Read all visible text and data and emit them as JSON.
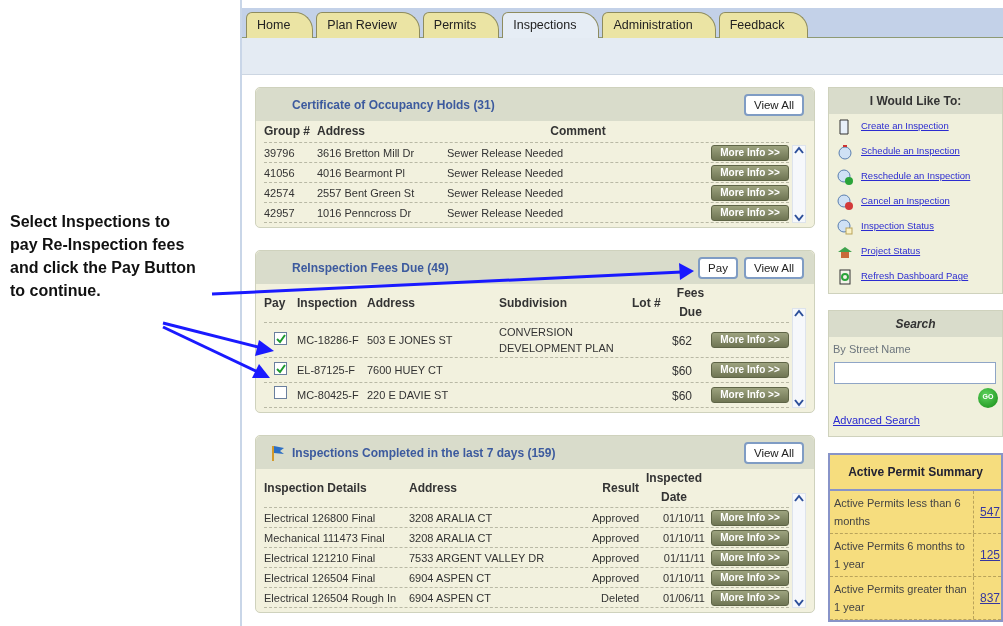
{
  "annotation": "Select Inspections to pay Re-Inspection fees and click the Pay Button to continue.",
  "tabs": [
    {
      "label": "Home",
      "selected": false
    },
    {
      "label": "Plan Review",
      "selected": false
    },
    {
      "label": "Permits",
      "selected": false
    },
    {
      "label": "Inspections",
      "selected": true
    },
    {
      "label": "Administration",
      "selected": false
    },
    {
      "label": "Feedback",
      "selected": false
    }
  ],
  "panels": [
    {
      "kind": "holds",
      "title": "Certificate of Occupancy Holds (31)",
      "buttons": [
        "View All"
      ],
      "columns": [
        "Group #",
        "Address",
        "Comment"
      ],
      "rows": [
        {
          "group": "39796",
          "address": "3616 Bretton Mill Dr",
          "comment": "Sewer Release Needed",
          "action": "More Info >>"
        },
        {
          "group": "41056",
          "address": "4016 Bearmont Pl",
          "comment": "Sewer Release Needed",
          "action": "More Info >>"
        },
        {
          "group": "42574",
          "address": "2557 Bent Green St",
          "comment": "Sewer Release Needed",
          "action": "More Info >>"
        },
        {
          "group": "42957",
          "address": "1016 Penncross Dr",
          "comment": "Sewer Release Needed",
          "action": "More Info >>"
        }
      ]
    },
    {
      "kind": "fees",
      "title": "ReInspection Fees Due (49)",
      "buttons": [
        "Pay",
        "View All"
      ],
      "columns": [
        "Pay",
        "Inspection",
        "Address",
        "Subdivision",
        "Lot #",
        "Fees Due"
      ],
      "rows": [
        {
          "checked": true,
          "inspection": "MC-18286-F",
          "address": "503 E JONES ST",
          "subdivision": "CONVERSION DEVELOPMENT PLAN",
          "fees_due": "$62",
          "action": "More Info >>"
        },
        {
          "checked": true,
          "inspection": "EL-87125-F",
          "address": "7600 HUEY CT",
          "fees_due": "$60",
          "action": "More Info >>"
        },
        {
          "checked": false,
          "inspection": "MC-80425-F",
          "address": "220 E DAVIE ST",
          "fees_due": "$60",
          "action": "More Info >>"
        }
      ]
    },
    {
      "kind": "completed",
      "title": "Inspections Completed in the last 7 days (159)",
      "buttons": [
        "View All"
      ],
      "columns": [
        "Inspection Details",
        "Address",
        "Result",
        "Inspected Date"
      ],
      "rows": [
        {
          "details": "Electrical 126800 Final",
          "address": "3208 ARALIA CT",
          "result": "Approved",
          "date": "01/10/11",
          "action": "More Info >>"
        },
        {
          "details": "Mechanical 111473 Final",
          "address": "3208 ARALIA CT",
          "result": "Approved",
          "date": "01/10/11",
          "action": "More Info >>"
        },
        {
          "details": "Electrical 121210 Final",
          "address": "7533 ARGENT VALLEY DR",
          "result": "Approved",
          "date": "01/11/11",
          "action": "More Info >>"
        },
        {
          "details": "Electrical 126504 Final",
          "address": "6904 ASPEN CT",
          "result": "Approved",
          "date": "01/10/11",
          "action": "More Info >>"
        },
        {
          "details": "Electrical 126504 Rough In",
          "address": "6904 ASPEN CT",
          "result": "Deleted",
          "date": "01/06/11",
          "action": "More Info >>"
        }
      ]
    }
  ],
  "actions": {
    "title": "I Would Like To:",
    "links": [
      {
        "kind": "document",
        "label": "Create an Inspection"
      },
      {
        "kind": "stopwatch",
        "label": "Schedule an Inspection"
      },
      {
        "kind": "clock-check",
        "label": "Reschedule an Inspection"
      },
      {
        "kind": "clock-cancel",
        "label": "Cancel an Inspection"
      },
      {
        "kind": "clock-document",
        "label": "Inspection Status"
      },
      {
        "kind": "house",
        "label": "Project Status"
      },
      {
        "kind": "refresh",
        "label": "Refresh Dashboard Page"
      }
    ]
  },
  "search": {
    "title": "Search",
    "label": "By Street Name",
    "go": "GO",
    "link": "Advanced Search"
  },
  "permit_summary": {
    "title": "Active Permit Summary",
    "rows": [
      {
        "label": "Active Permits less than 6 months",
        "count": "547"
      },
      {
        "label": "Active Permits 6 months to 1 year",
        "count": "125"
      },
      {
        "label": "Active Permits greater than 1 year",
        "count": "837"
      }
    ]
  }
}
